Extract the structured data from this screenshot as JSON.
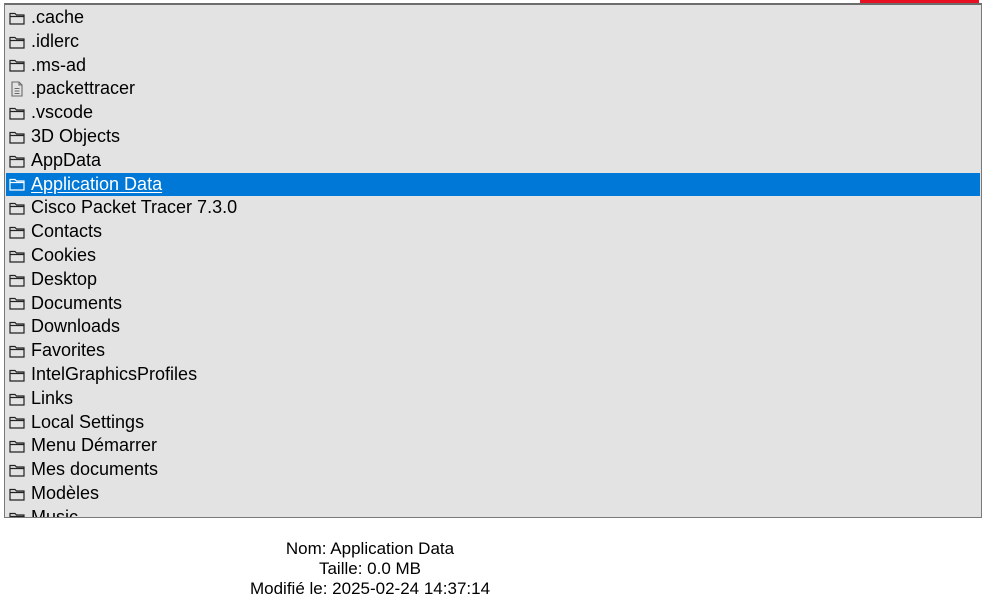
{
  "colors": {
    "list_bg": "#e3e3e3",
    "selection_bg": "#0078d7",
    "selection_text": "#ffffff",
    "close_red": "#e81123"
  },
  "file_list": {
    "selected_index": 7,
    "items": [
      {
        "label": ".cache",
        "icon": "folder-icon"
      },
      {
        "label": ".idlerc",
        "icon": "folder-icon"
      },
      {
        "label": ".ms-ad",
        "icon": "folder-icon"
      },
      {
        "label": ".packettracer",
        "icon": "file-icon"
      },
      {
        "label": ".vscode",
        "icon": "folder-icon"
      },
      {
        "label": "3D Objects",
        "icon": "folder-icon"
      },
      {
        "label": "AppData",
        "icon": "folder-icon"
      },
      {
        "label": "Application Data",
        "icon": "folder-icon"
      },
      {
        "label": "Cisco Packet Tracer 7.3.0",
        "icon": "folder-icon"
      },
      {
        "label": "Contacts",
        "icon": "folder-icon"
      },
      {
        "label": "Cookies",
        "icon": "folder-icon"
      },
      {
        "label": "Desktop",
        "icon": "folder-icon"
      },
      {
        "label": "Documents",
        "icon": "folder-icon"
      },
      {
        "label": "Downloads",
        "icon": "folder-icon"
      },
      {
        "label": "Favorites",
        "icon": "folder-icon"
      },
      {
        "label": "IntelGraphicsProfiles",
        "icon": "folder-icon"
      },
      {
        "label": "Links",
        "icon": "folder-icon"
      },
      {
        "label": "Local Settings",
        "icon": "folder-icon"
      },
      {
        "label": "Menu Démarrer",
        "icon": "folder-icon"
      },
      {
        "label": "Mes documents",
        "icon": "folder-icon"
      },
      {
        "label": "Modèles",
        "icon": "folder-icon"
      },
      {
        "label": "Music",
        "icon": "folder-icon"
      }
    ]
  },
  "details": {
    "name": "Nom: Application Data",
    "size": "Taille: 0.0 MB",
    "modified": "Modifié le: 2025-02-24 14:37:14"
  }
}
